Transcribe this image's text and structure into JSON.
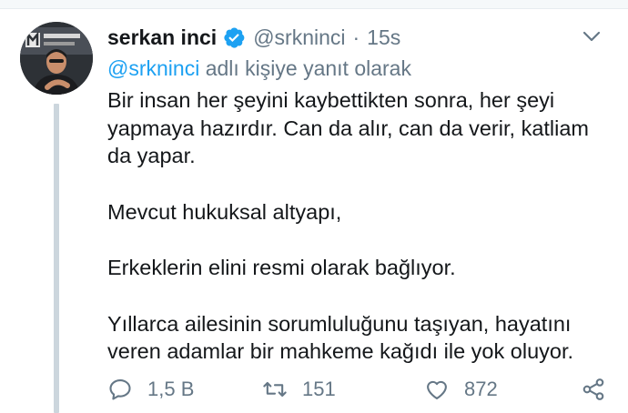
{
  "tweet": {
    "display_name": "serkan inci",
    "handle": "@srkninci",
    "separator": "·",
    "timestamp": "15s",
    "reply_mention": "@srkninci",
    "reply_suffix": " adlı kişiye yanıt olarak",
    "paragraphs": [
      "Bir insan her şeyini kaybettikten sonra, her şeyi yapmaya hazırdır. Can da alır, can da verir, katliam da yapar.",
      "Mevcut hukuksal altyapı,",
      "Erkeklerin elini resmi olarak bağlıyor.",
      "Yıllarca ailesinin sorumluluğunu taşıyan, hayatını veren adamlar bir mahkeme kağıdı ile yok oluyor."
    ]
  },
  "actions": {
    "reply_count": "1,5 B",
    "retweet_count": "151",
    "like_count": "872"
  },
  "icons": {
    "verified": "verified-badge-icon",
    "menu": "chevron-down-icon",
    "reply": "reply-icon",
    "retweet": "retweet-icon",
    "like": "heart-icon",
    "share": "share-icon"
  },
  "colors": {
    "accent": "#1da1f2",
    "muted": "#657786",
    "text": "#14171a",
    "thread_line": "#ccd6dd"
  }
}
